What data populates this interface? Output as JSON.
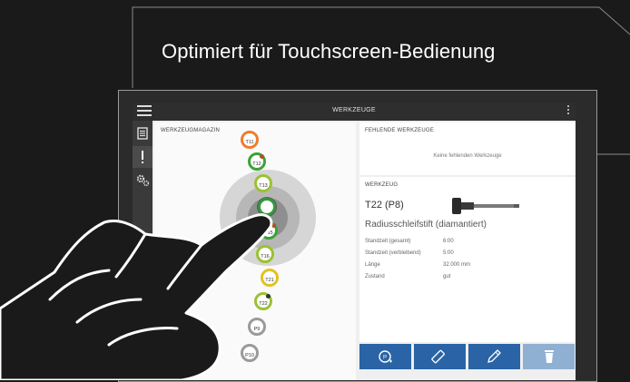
{
  "headline": "Optimiert für Touchscreen-Bedienung",
  "app": {
    "title": "WERKZEUGE",
    "menu_icon": "hamburger-menu-icon",
    "more_icon": "kebab-menu-icon"
  },
  "sidebar": {
    "items": [
      {
        "icon": "list-icon",
        "active": false
      },
      {
        "icon": "alert-icon",
        "active": true
      },
      {
        "icon": "gears-icon",
        "active": false
      }
    ]
  },
  "magazine": {
    "title": "WERKZEUGMAGAZIN",
    "slots": [
      {
        "label": "T11",
        "ring": "#f07d2c",
        "dot": ""
      },
      {
        "label": "T12",
        "ring": "#3aa335",
        "dot": "#b0502a"
      },
      {
        "label": "T13",
        "ring": "#9ac234",
        "dot": ""
      },
      {
        "label": "",
        "ring": "#2f9a3a",
        "dot": "",
        "selected": true
      },
      {
        "label": "T15",
        "ring": "#3aa335",
        "dot": "#b0502a"
      },
      {
        "label": "T16",
        "ring": "#9ac234",
        "dot": ""
      },
      {
        "label": "T21",
        "ring": "#e3c21f",
        "dot": ""
      },
      {
        "label": "T22",
        "ring": "#9ac234",
        "dot": "#333333"
      },
      {
        "label": "P9",
        "ring": "#9a9a9a",
        "dot": ""
      },
      {
        "label": "P10",
        "ring": "#9a9a9a",
        "dot": ""
      }
    ]
  },
  "missing": {
    "title": "FEHLENDE WERKZEUGE",
    "message": "Keine fehlenden Werkzeuge"
  },
  "tool": {
    "title": "WERKZEUG",
    "id": "T22 (P8)",
    "name": "Radiusschleifstift (diamantiert)",
    "properties": [
      {
        "key": "Standzeit (gesamt)",
        "value": "6:00"
      },
      {
        "key": "Standzeit (verbleibend)",
        "value": "5:00"
      },
      {
        "key": "Länge",
        "value": "32.000 mm"
      },
      {
        "key": "Zustand",
        "value": "gut"
      }
    ]
  },
  "actions": [
    {
      "icon": "load-tool-icon",
      "enabled": true
    },
    {
      "icon": "measure-icon",
      "enabled": true
    },
    {
      "icon": "edit-icon",
      "enabled": true
    },
    {
      "icon": "delete-icon",
      "enabled": false
    }
  ],
  "colors": {
    "accent": "#2a64a6",
    "background": "#1a1a1a",
    "app_bar": "#2e2e2e"
  }
}
